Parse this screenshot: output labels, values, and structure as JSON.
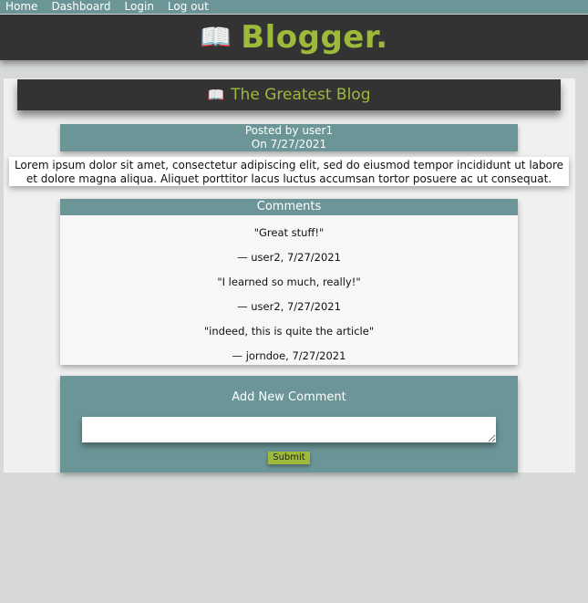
{
  "nav": {
    "items": [
      {
        "label": "Home"
      },
      {
        "label": "Dashboard"
      },
      {
        "label": "Login"
      },
      {
        "label": "Log out"
      }
    ]
  },
  "header": {
    "book_icon": "📖",
    "title": "Blogger."
  },
  "post": {
    "book_icon": "📖",
    "title": "The Greatest Blog",
    "posted_by": "Posted by user1",
    "date": "On 7/27/2021",
    "body": "Lorem ipsum dolor sit amet, consectetur adipiscing elit, sed do eiusmod tempor incididunt ut labore et dolore magna aliqua. Aliquet porttitor lacus luctus accumsan tortor posuere ac ut consequat."
  },
  "comments": {
    "heading": "Comments",
    "items": [
      {
        "text": "\"Great stuff!\"",
        "attribution": "— user2, 7/27/2021"
      },
      {
        "text": "\"I learned so much, really!\"",
        "attribution": "— user2, 7/27/2021"
      },
      {
        "text": "\"indeed, this is quite the article\"",
        "attribution": "— jorndoe, 7/27/2021"
      }
    ]
  },
  "add_comment": {
    "heading": "Add New Comment",
    "textarea_value": "",
    "submit_label": "Submit"
  },
  "colors": {
    "accent": "#9dba3a",
    "teal": "#6b9597",
    "dark": "#333333",
    "page_bg": "#d6d9d8"
  }
}
